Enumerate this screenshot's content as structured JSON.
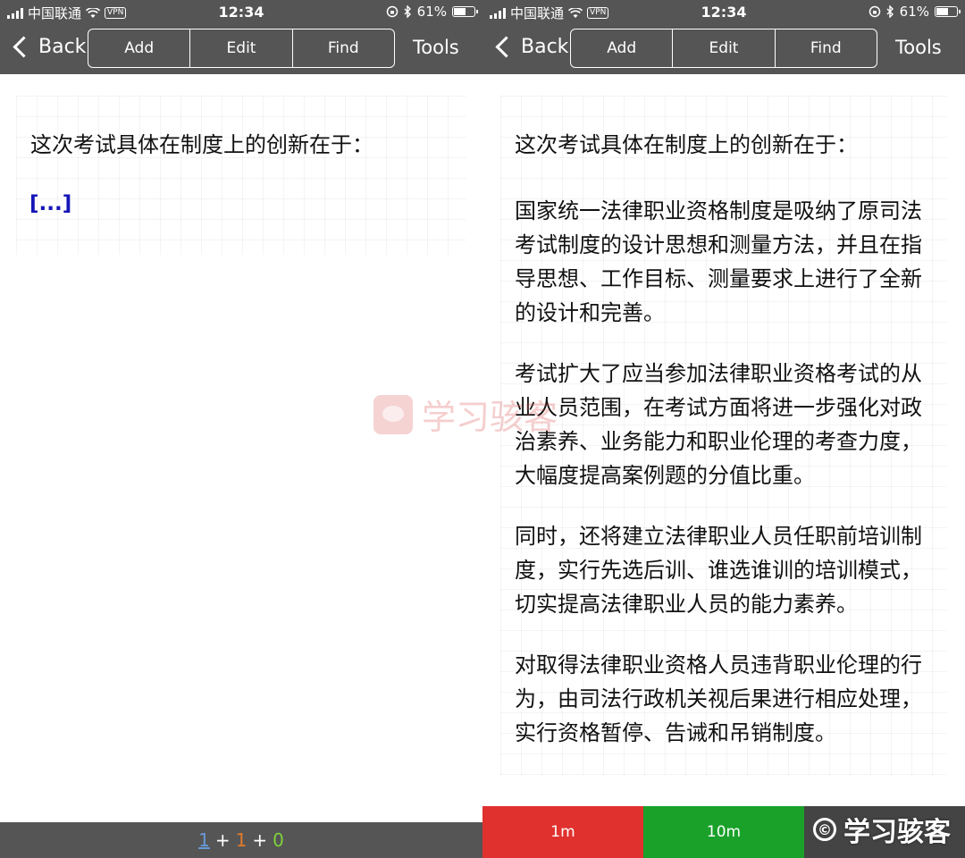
{
  "status": {
    "carrier": "中国联通",
    "vpn": "VPN",
    "time": "12:34",
    "battery": "61%",
    "battery_level": 0.61
  },
  "nav": {
    "back": "Back",
    "add": "Add",
    "edit": "Edit",
    "find": "Find",
    "tools": "Tools"
  },
  "left": {
    "question": "这次考试具体在制度上的创新在于：",
    "cloze": "[...]",
    "counts": {
      "new": "1",
      "learning": "1",
      "review": "0"
    }
  },
  "right": {
    "question": "这次考试具体在制度上的创新在于：",
    "paragraphs": [
      "国家统一法律职业资格制度是吸纳了原司法考试制度的设计思想和测量方法，并且在指导思想、工作目标、测量要求上进行了全新的设计和完善。",
      "考试扩大了应当参加法律职业资格考试的从业人员范围，在考试方面将进一步强化对政治素养、业务能力和职业伦理的考查力度，大幅度提高案例题的分值比重。",
      "同时，还将建立法律职业人员任职前培训制度，实行先选后训、谁选谁训的培训模式，切实提高法律职业人员的能力素养。",
      "对取得法律职业资格人员违背职业伦理的行为，由司法行政机关视后果进行相应处理，实行资格暂停、告诫和吊销制度。"
    ],
    "buttons": {
      "again": "1m",
      "good": "10m"
    }
  },
  "watermark": {
    "text": "学习骇客",
    "corner_symbol": "©"
  },
  "colors": {
    "bar": "#555555",
    "cloze": "#1515b8",
    "again": "#e0312e",
    "good": "#1aa12a",
    "count_new": "#6a9ad8",
    "count_learning": "#e07a2e",
    "count_review": "#7fd13a"
  }
}
